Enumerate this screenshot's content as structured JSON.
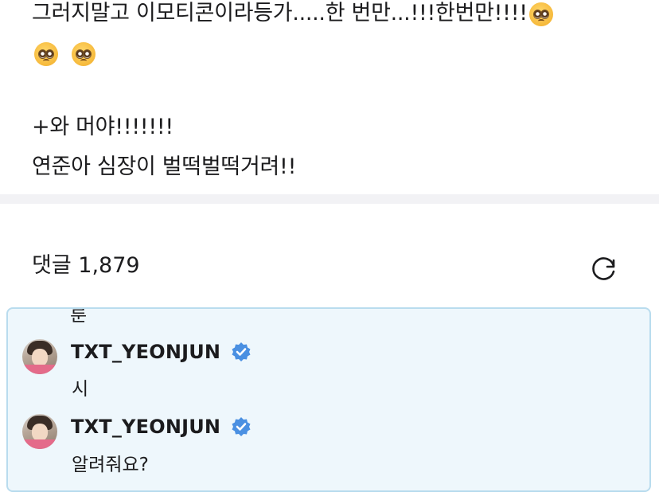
{
  "post": {
    "line1": "그러지말고 이모티콘이라등가.....한 번만...!!!한번만!!!!",
    "line3": "+와 머야!!!!!!!",
    "line4": "연준아 심장이 벌떡벌떡거려!!",
    "emoji_icon": "pleading-face-emoji"
  },
  "comments": {
    "header": "댓글 1,879",
    "refresh_icon": "refresh-icon"
  },
  "comment_thread": {
    "fragment_top": "룬",
    "items": [
      {
        "username": "TXT_YEONJUN",
        "text": "시"
      },
      {
        "username": "TXT_YEONJUN",
        "text": "알려줘요?"
      }
    ],
    "verified_color": "#4a90e2",
    "highlight_bg": "#eef7fc",
    "highlight_border": "#b9dcee"
  }
}
